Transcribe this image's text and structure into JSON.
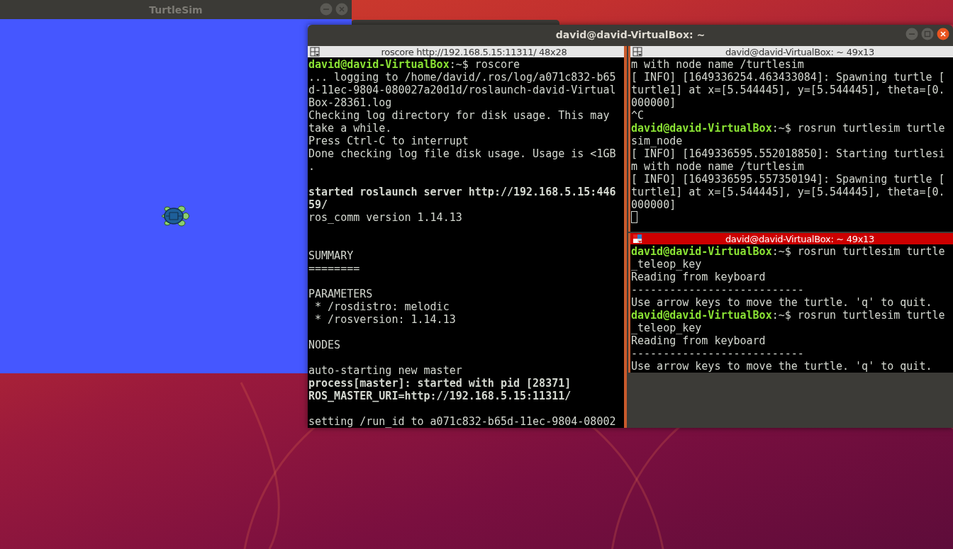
{
  "turtlesim_window": {
    "title": "TurtleSim",
    "focused": false,
    "buttons": [
      {
        "kind": "minimize"
      },
      {
        "kind": "close"
      }
    ]
  },
  "terminal_window": {
    "title": "david@david-VirtualBox: ~",
    "focused": true,
    "buttons": [
      {
        "kind": "minimize"
      },
      {
        "kind": "maximize"
      },
      {
        "kind": "close"
      }
    ],
    "panes": [
      {
        "title": "roscore http://192.168.5.15:11311/ 48x28",
        "focused": false,
        "lines": [
          {
            "kind": "prompt",
            "prompt": "david@david-VirtualBox",
            "text": ":~$ roscore"
          },
          {
            "kind": "plain",
            "text": "... logging to /home/david/.ros/log/a071c832-b65"
          },
          {
            "kind": "plain",
            "text": "d-11ec-9804-080027a20d1d/roslaunch-david-Virtual"
          },
          {
            "kind": "plain",
            "text": "Box-28361.log"
          },
          {
            "kind": "plain",
            "text": "Checking log directory for disk usage. This may"
          },
          {
            "kind": "plain",
            "text": "take a while."
          },
          {
            "kind": "plain",
            "text": "Press Ctrl-C to interrupt"
          },
          {
            "kind": "plain",
            "text": "Done checking log file disk usage. Usage is <1GB"
          },
          {
            "kind": "plain",
            "text": "."
          },
          {
            "kind": "blank"
          },
          {
            "kind": "bold",
            "text": "started roslaunch server http://192.168.5.15:446"
          },
          {
            "kind": "bold",
            "text": "59/"
          },
          {
            "kind": "plain",
            "text": "ros_comm version 1.14.13"
          },
          {
            "kind": "blank"
          },
          {
            "kind": "blank"
          },
          {
            "kind": "plain",
            "text": "SUMMARY"
          },
          {
            "kind": "plain",
            "text": "========"
          },
          {
            "kind": "blank"
          },
          {
            "kind": "plain",
            "text": "PARAMETERS"
          },
          {
            "kind": "plain",
            "text": " * /rosdistro: melodic"
          },
          {
            "kind": "plain",
            "text": " * /rosversion: 1.14.13"
          },
          {
            "kind": "blank"
          },
          {
            "kind": "plain",
            "text": "NODES"
          },
          {
            "kind": "blank"
          },
          {
            "kind": "plain",
            "text": "auto-starting new master"
          },
          {
            "kind": "bold",
            "text": "process[master]: started with pid [28371]"
          },
          {
            "kind": "bold",
            "text": "ROS_MASTER_URI=http://192.168.5.15:11311/"
          },
          {
            "kind": "blank"
          },
          {
            "kind": "plain",
            "text": "setting /run_id to a071c832-b65d-11ec-9804-08002"
          }
        ]
      },
      {
        "title": "david@david-VirtualBox: ~ 49x13",
        "focused": false,
        "lines": [
          {
            "kind": "plain",
            "text": "m with node name /turtlesim"
          },
          {
            "kind": "plain",
            "text": "[ INFO] [1649336254.463433084]: Spawning turtle ["
          },
          {
            "kind": "plain",
            "text": "turtle1] at x=[5.544445], y=[5.544445], theta=[0."
          },
          {
            "kind": "plain",
            "text": "000000]"
          },
          {
            "kind": "plain",
            "text": "^C"
          },
          {
            "kind": "prompt",
            "prompt": "david@david-VirtualBox",
            "text": ":~$ rosrun turtlesim turtle"
          },
          {
            "kind": "plain",
            "text": "sim_node"
          },
          {
            "kind": "plain",
            "text": "[ INFO] [1649336595.552018850]: Starting turtlesi"
          },
          {
            "kind": "plain",
            "text": "m with node name /turtlesim"
          },
          {
            "kind": "plain",
            "text": "[ INFO] [1649336595.557350194]: Spawning turtle ["
          },
          {
            "kind": "plain",
            "text": "turtle1] at x=[5.544445], y=[5.544445], theta=[0."
          },
          {
            "kind": "plain",
            "text": "000000]"
          },
          {
            "kind": "cursor"
          }
        ]
      },
      {
        "title": "david@david-VirtualBox: ~ 49x13",
        "focused": true,
        "lines": [
          {
            "kind": "prompt",
            "prompt": "david@david-VirtualBox",
            "text": ":~$ rosrun turtlesim turtle"
          },
          {
            "kind": "plain",
            "text": "_teleop_key"
          },
          {
            "kind": "plain",
            "text": "Reading from keyboard"
          },
          {
            "kind": "plain",
            "text": "---------------------------"
          },
          {
            "kind": "plain",
            "text": "Use arrow keys to move the turtle. 'q' to quit."
          },
          {
            "kind": "prompt",
            "prompt": "david@david-VirtualBox",
            "text": ":~$ rosrun turtlesim turtle"
          },
          {
            "kind": "plain",
            "text": "_teleop_key"
          },
          {
            "kind": "plain",
            "text": "Reading from keyboard"
          },
          {
            "kind": "plain",
            "text": "---------------------------"
          },
          {
            "kind": "plain",
            "text": "Use arrow keys to move the turtle. 'q' to quit."
          }
        ]
      }
    ]
  }
}
